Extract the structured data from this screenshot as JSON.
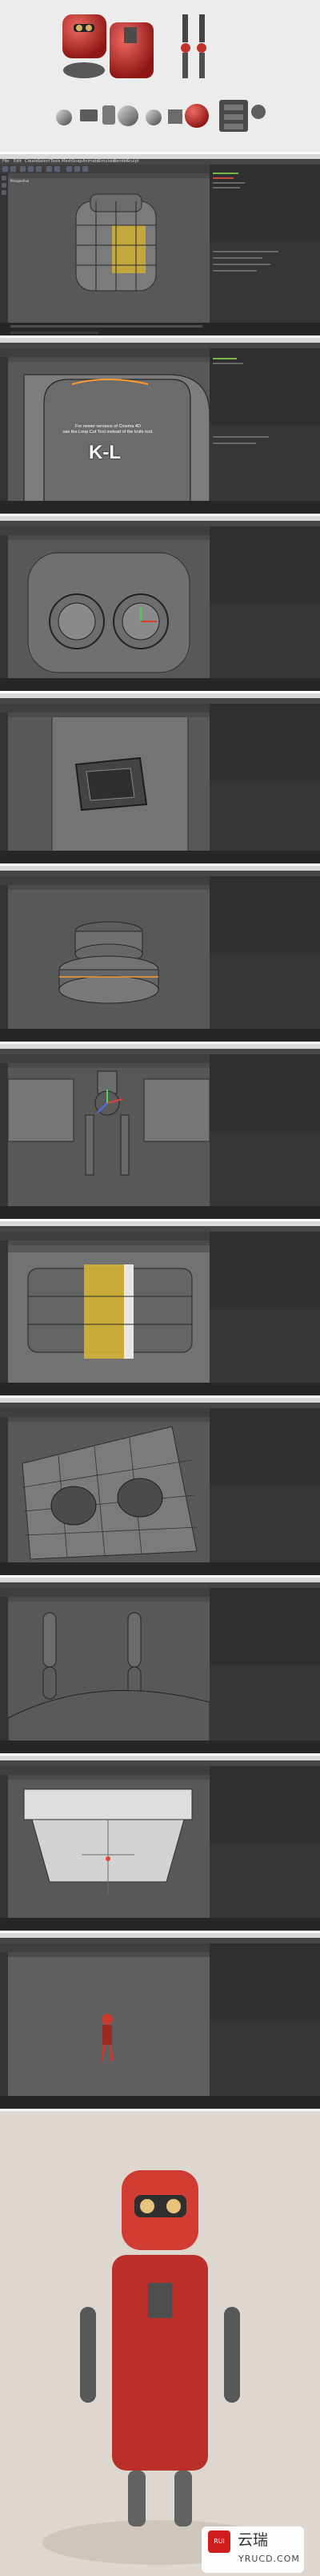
{
  "app": {
    "title": "CINEMA 4D",
    "menus": [
      "File",
      "Edit",
      "Create",
      "Select",
      "Tools",
      "Mesh",
      "Snap",
      "Animate",
      "Simulate",
      "Render",
      "Sculpt",
      "MoGraph",
      "Character",
      "Plugins",
      "Script",
      "Window",
      "Help"
    ]
  },
  "viewport": {
    "label": "Perspective"
  },
  "overlays": {
    "tip_line1": "For newer versions of Cinema 4D",
    "tip_line2": "use the Loop Cut Tool instead of the knife tool.",
    "shortcut": "K-L"
  },
  "watermark": {
    "cn": "云瑞",
    "en": "YRUCD.COM",
    "badge": "RUI"
  },
  "colors": {
    "bg": "#e8e6e2",
    "accent_red": "#c2332c",
    "ui_dark": "#3a3a3a"
  }
}
